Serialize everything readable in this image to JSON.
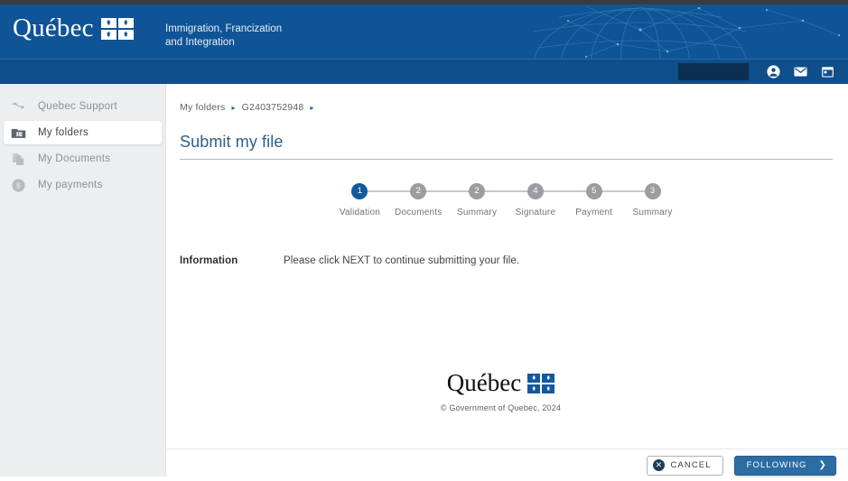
{
  "colors": {
    "header_blue": "#0f5496",
    "nav_blue": "#0e4e8b",
    "accent_blue": "#14599e",
    "button_blue": "#2b6ca3",
    "sidebar_gray": "#eceef0",
    "step_gray": "#9a9da1"
  },
  "header": {
    "logo_text": "Québec",
    "logo_icon": "quebec-flag-grid-icon",
    "tagline_line1": "Immigration, Francization",
    "tagline_line2": "and Integration",
    "graphic": "globe-network-graphic"
  },
  "navbar": {
    "redacted_field": "",
    "icons": [
      {
        "name": "account-icon",
        "glyph": "person"
      },
      {
        "name": "mail-icon",
        "glyph": "envelope"
      },
      {
        "name": "calendar-icon",
        "glyph": "calendar"
      }
    ]
  },
  "sidebar": {
    "items": [
      {
        "label": "Quebec Support",
        "icon": "support-squiggle-icon",
        "active": false
      },
      {
        "label": "My folders",
        "icon": "folder-contact-icon",
        "active": true
      },
      {
        "label": "My Documents",
        "icon": "documents-copy-icon",
        "active": false
      },
      {
        "label": "My payments",
        "icon": "dollar-circle-icon",
        "active": false
      }
    ]
  },
  "breadcrumb": {
    "items": [
      "My folders",
      "G2403752948"
    ],
    "separator": "▸"
  },
  "page": {
    "title": "Submit my file"
  },
  "stepper": {
    "steps": [
      {
        "number": "1",
        "label": "Validation",
        "current": true
      },
      {
        "number": "2",
        "label": "Documents",
        "current": false
      },
      {
        "number": "2",
        "label": "Summary",
        "current": false
      },
      {
        "number": "4",
        "label": "Signature",
        "current": false
      },
      {
        "number": "5",
        "label": "Payment",
        "current": false
      },
      {
        "number": "3",
        "label": "Summary",
        "current": false
      }
    ]
  },
  "information": {
    "label": "Information",
    "text": "Please click NEXT to continue submitting your file."
  },
  "footer": {
    "logo_text": "Québec",
    "copyright": "© Government of Quebec, 2024"
  },
  "actions": {
    "cancel_label": "CANCEL",
    "cancel_icon": "x-circle-icon",
    "next_label": "FOLLOWING",
    "next_icon": "chevron-right-icon",
    "cancel_glyph": "✕",
    "next_glyph": "❯"
  }
}
